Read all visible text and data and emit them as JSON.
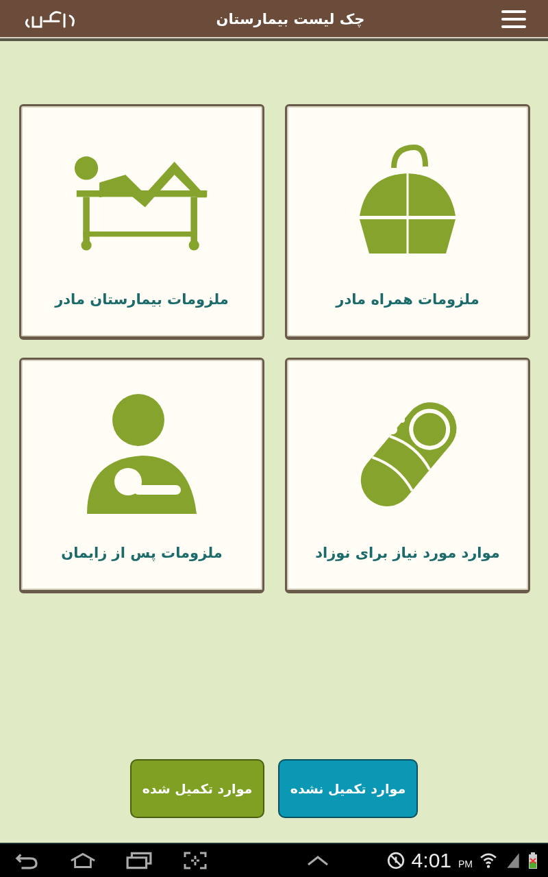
{
  "app_bar": {
    "title": "چک لیست بیمارستان"
  },
  "categories": [
    {
      "kind": "bag",
      "label": "ملزومات همراه مادر"
    },
    {
      "kind": "bed",
      "label": "ملزومات بیمارستان مادر"
    },
    {
      "kind": "baby",
      "label": "موارد مورد نیاز برای نوزاد"
    },
    {
      "kind": "nursing",
      "label": "ملزومات پس از زایمان"
    }
  ],
  "buttons": [
    {
      "kind": "incomplete",
      "label": "موارد تکمیل نشده"
    },
    {
      "kind": "complete",
      "label": "موارد تکمیل شده"
    }
  ],
  "status_bar": {
    "time": "4:01",
    "period": "PM"
  }
}
